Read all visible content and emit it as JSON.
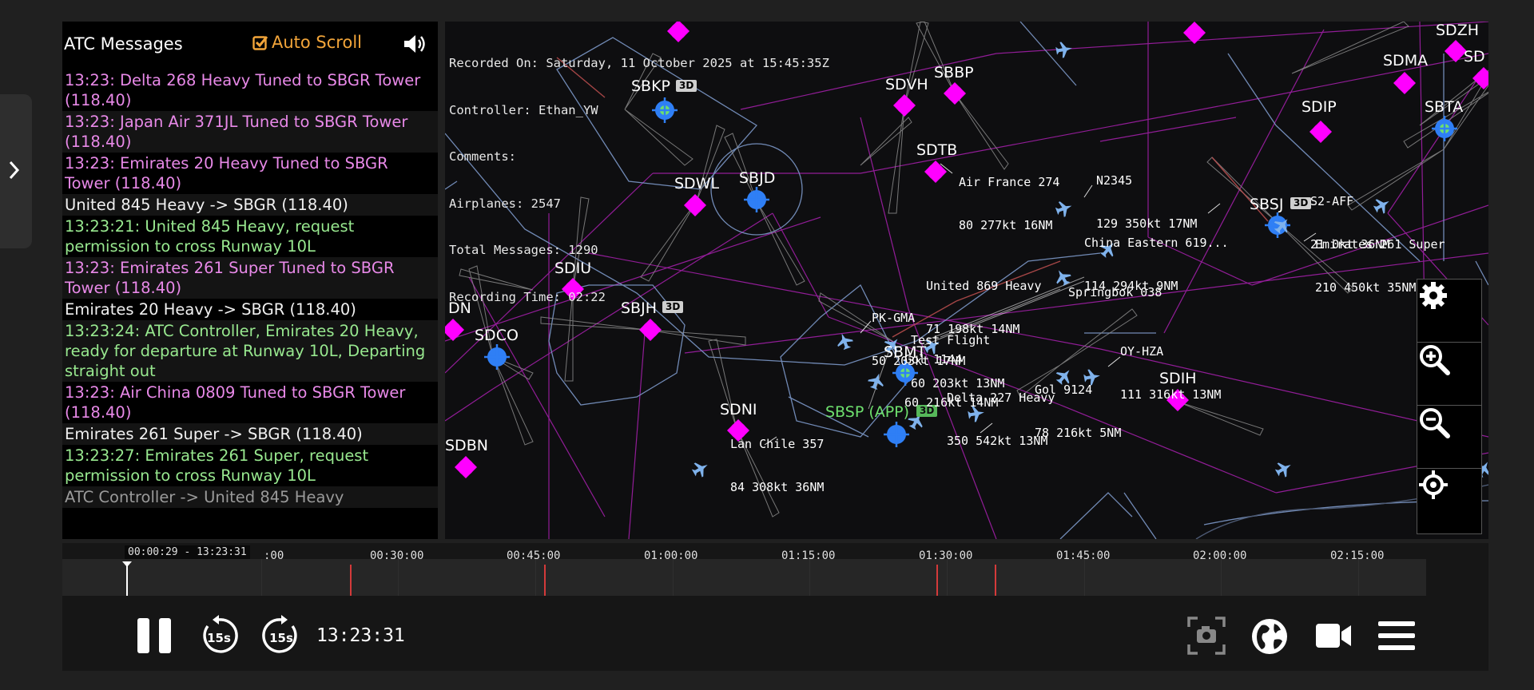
{
  "atc": {
    "title": "ATC Messages",
    "auto_scroll_label": "Auto Scroll",
    "auto_scroll_checked": true,
    "messages": [
      {
        "text": "13:23: Delta 268 Heavy Tuned to SBGR Tower (118.40)",
        "kind": "purple"
      },
      {
        "text": "13:23: Japan Air 371JL Tuned to SBGR Tower (118.40)",
        "kind": "purple"
      },
      {
        "text": "13:23: Emirates 20 Heavy Tuned to SBGR Tower (118.40)",
        "kind": "purple"
      },
      {
        "text": "United 845 Heavy -> SBGR (118.40)",
        "kind": "white"
      },
      {
        "text": "13:23:21: United 845 Heavy, request permission to cross Runway 10L",
        "kind": "green"
      },
      {
        "text": "13:23: Emirates 261 Super Tuned to SBGR Tower (118.40)",
        "kind": "purple"
      },
      {
        "text": "Emirates 20 Heavy -> SBGR (118.40)",
        "kind": "white"
      },
      {
        "text": "13:23:24: ATC Controller, Emirates 20 Heavy, ready for departure at Runway 10L, Departing straight out",
        "kind": "green"
      },
      {
        "text": "13:23: Air China 0809 Tuned to SBGR Tower (118.40)",
        "kind": "purple"
      },
      {
        "text": "Emirates 261 Super -> SBGR (118.40)",
        "kind": "white"
      },
      {
        "text": "13:23:27: Emirates 261 Super, request permission to cross Runway 10L",
        "kind": "green"
      },
      {
        "text": "ATC Controller -> United 845 Heavy",
        "kind": "grey"
      }
    ]
  },
  "recording": {
    "recorded_on": "Recorded On: Saturday, 11 October 2025 at 15:45:35Z",
    "controller": "Controller: Ethan_YW",
    "comments": "Comments:",
    "airplanes": "Airplanes: 2547",
    "total_messages": "Total Messages: 1290",
    "recording_time": "Recording Time: 02:22"
  },
  "map": {
    "fixes": [
      {
        "name": "SBKP",
        "type": "airport",
        "badge": "3D"
      },
      {
        "name": "SDVH",
        "type": "fix"
      },
      {
        "name": "SBBP",
        "type": "fix"
      },
      {
        "name": "SDTB",
        "type": "fix"
      },
      {
        "name": "SDWL",
        "type": "fix"
      },
      {
        "name": "SBJD",
        "type": "airport"
      },
      {
        "name": "SDIU",
        "type": "fix"
      },
      {
        "name": "SBJH",
        "type": "fix",
        "badge": "3D"
      },
      {
        "name": "DN",
        "type": "fix"
      },
      {
        "name": "SDCO",
        "type": "airport"
      },
      {
        "name": "SDBN",
        "type": "fix"
      },
      {
        "name": "SDNI",
        "type": "fix"
      },
      {
        "name": "SBMT",
        "type": "airport-active"
      },
      {
        "name": "SBSP (APP)",
        "type": "airport-app",
        "badge": "3D"
      },
      {
        "name": "SDIH",
        "type": "fix"
      },
      {
        "name": "SDIP",
        "type": "fix"
      },
      {
        "name": "SDMA",
        "type": "fix"
      },
      {
        "name": "SDZH",
        "type": "fix"
      },
      {
        "name": "SD",
        "type": "fix"
      },
      {
        "name": "SBTA",
        "type": "airport-active"
      },
      {
        "name": "SBSJ",
        "type": "airport",
        "badge": "3D"
      }
    ],
    "aircraft": [
      {
        "callsign": "Air France 274",
        "data": "80 277kt 16NM"
      },
      {
        "callsign": "N2345",
        "data": "129 350kt 17NM"
      },
      {
        "callsign": "S2-AFF",
        "data": "21 0kt 36NM"
      },
      {
        "callsign": "China Eastern 619...",
        "data": "114 294kt 9NM"
      },
      {
        "callsign": "Emirates 261 Super",
        "data": "210 450kt 35NM"
      },
      {
        "callsign": "United 869 Heavy",
        "data": "71 198kt 14NM"
      },
      {
        "callsign": "Springbok 038",
        "data": ""
      },
      {
        "callsign": "PK-GMA",
        "data": "50 203kt 17NM"
      },
      {
        "callsign": "Test Flight",
        "data": "60 203kt 13NM"
      },
      {
        "callsign": "Gol 1144",
        "data": "60 216kt 14NM"
      },
      {
        "callsign": "OY-HZA",
        "data": "111 316kt 13NM"
      },
      {
        "callsign": "Delta 227 Heavy",
        "data": "350 542kt 13NM"
      },
      {
        "callsign": "Gol 9124",
        "data": "78 216kt 5NM"
      },
      {
        "callsign": "Lan Chile 357",
        "data": "84 308kt 36NM"
      }
    ],
    "buttons": [
      {
        "name": "settings",
        "icon": "gear-icon"
      },
      {
        "name": "zoom-in",
        "icon": "zoom-in-icon"
      },
      {
        "name": "zoom-out",
        "icon": "zoom-out-icon"
      },
      {
        "name": "recenter",
        "icon": "crosshair-icon"
      }
    ]
  },
  "timeline": {
    "cursor_label": "00:00:29 - 13:23:31",
    "ticks": [
      ":00",
      "00:30:00",
      "00:45:00",
      "01:00:00",
      "01:15:00",
      "01:30:00",
      "01:45:00",
      "02:00:00",
      "02:15:00"
    ],
    "current_time": "13:23:31",
    "skip_back_label": "15s",
    "skip_forward_label": "15s"
  },
  "colors": {
    "fix": "#ff00ff",
    "airport": "#2f7ff5",
    "active_airport": "#6ee06e",
    "auto_scroll": "#f2a53a",
    "message_purple": "#e889e8",
    "message_green": "#98e88f",
    "event_marker": "#d43a3a"
  }
}
